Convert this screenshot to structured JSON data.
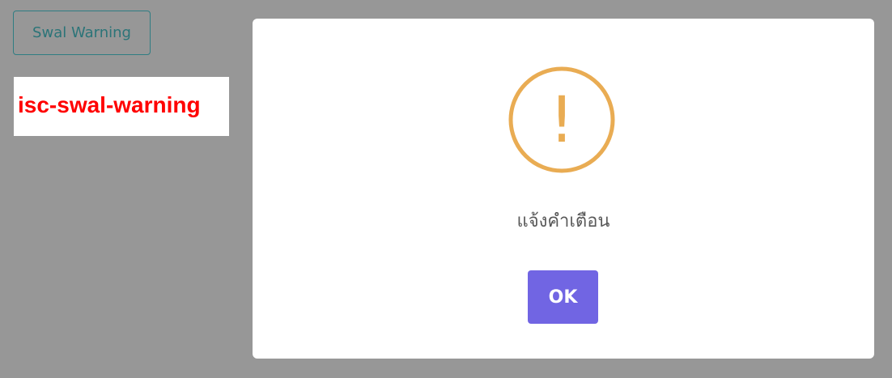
{
  "page": {
    "background_color": "#979797"
  },
  "trigger": {
    "label": "Swal Warning",
    "border_color": "#2f7d83"
  },
  "class_label": {
    "text": "isc-swal-warning",
    "color": "#ff0000"
  },
  "modal": {
    "icon": "warning-icon",
    "icon_glyph": "!",
    "icon_color": "#e9ac53",
    "title": "แจ้งคำเตือน",
    "confirm_label": "OK",
    "confirm_color": "#7165e3"
  }
}
